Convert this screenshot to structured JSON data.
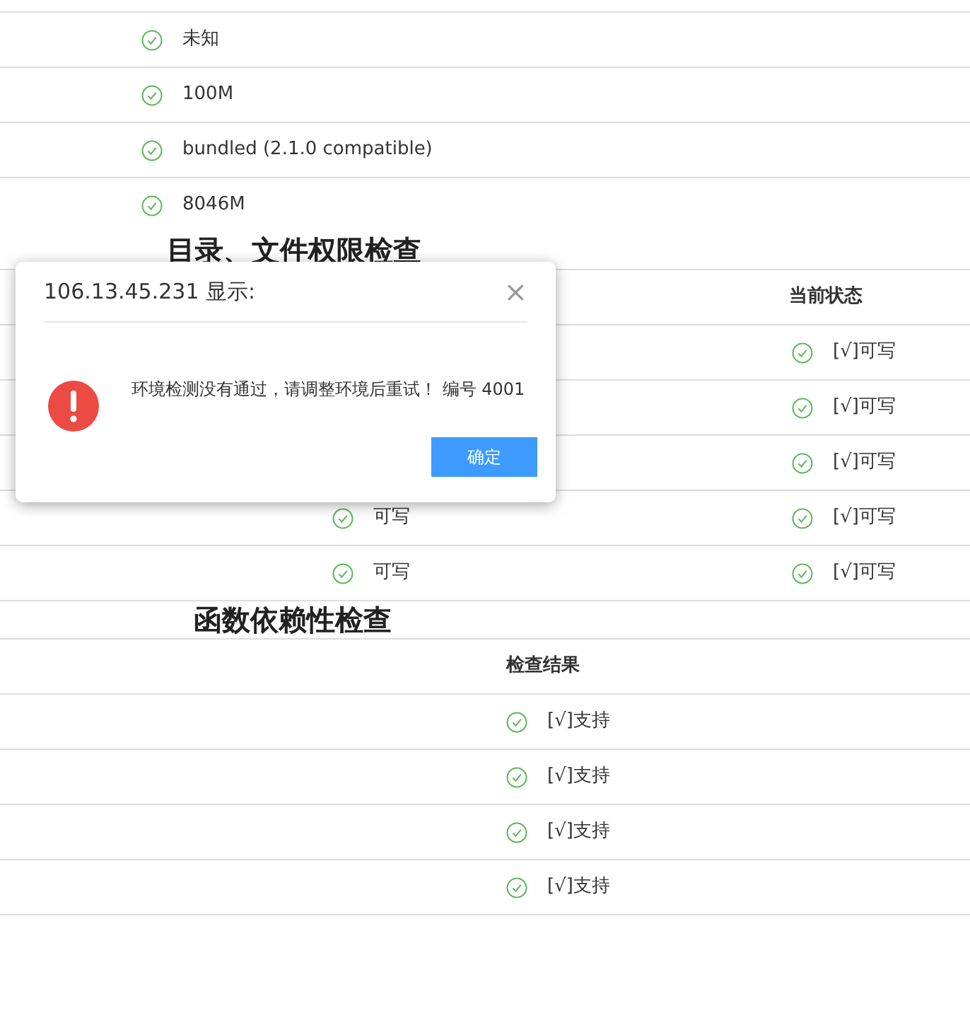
{
  "env_table": {
    "rows": [
      {
        "result": "未知",
        "passed": true
      },
      {
        "result": "100M",
        "passed": true
      },
      {
        "result": "bundled (2.1.0 compatible)",
        "passed": true
      },
      {
        "result": "8046M",
        "passed": true
      }
    ]
  },
  "dir_section": {
    "heading": "目录、文件权限检查",
    "columns": {
      "column_3": "当前状态"
    },
    "rows": [
      {
        "current": "[√]可写",
        "passed": true
      },
      {
        "current": "[√]可写",
        "passed": true
      },
      {
        "current": "[√]可写",
        "passed": true
      },
      {
        "required": "可写",
        "current": "[√]可写",
        "passed": true
      },
      {
        "required": "可写",
        "current": "[√]可写",
        "passed": true
      }
    ]
  },
  "func_section": {
    "heading": "函数依赖性检查",
    "columns": {
      "column_2": "检查结果"
    },
    "rows": [
      {
        "result": "[√]支持",
        "passed": true
      },
      {
        "result": "[√]支持",
        "passed": true
      },
      {
        "result": "[√]支持",
        "passed": true
      },
      {
        "result": "[√]支持",
        "passed": true
      }
    ]
  },
  "dialog": {
    "title": "106.13.45.231 显示:",
    "close": "×",
    "message": "环境检测没有通过，请调整环境后重试！ 编号 4001",
    "button": "确定"
  }
}
